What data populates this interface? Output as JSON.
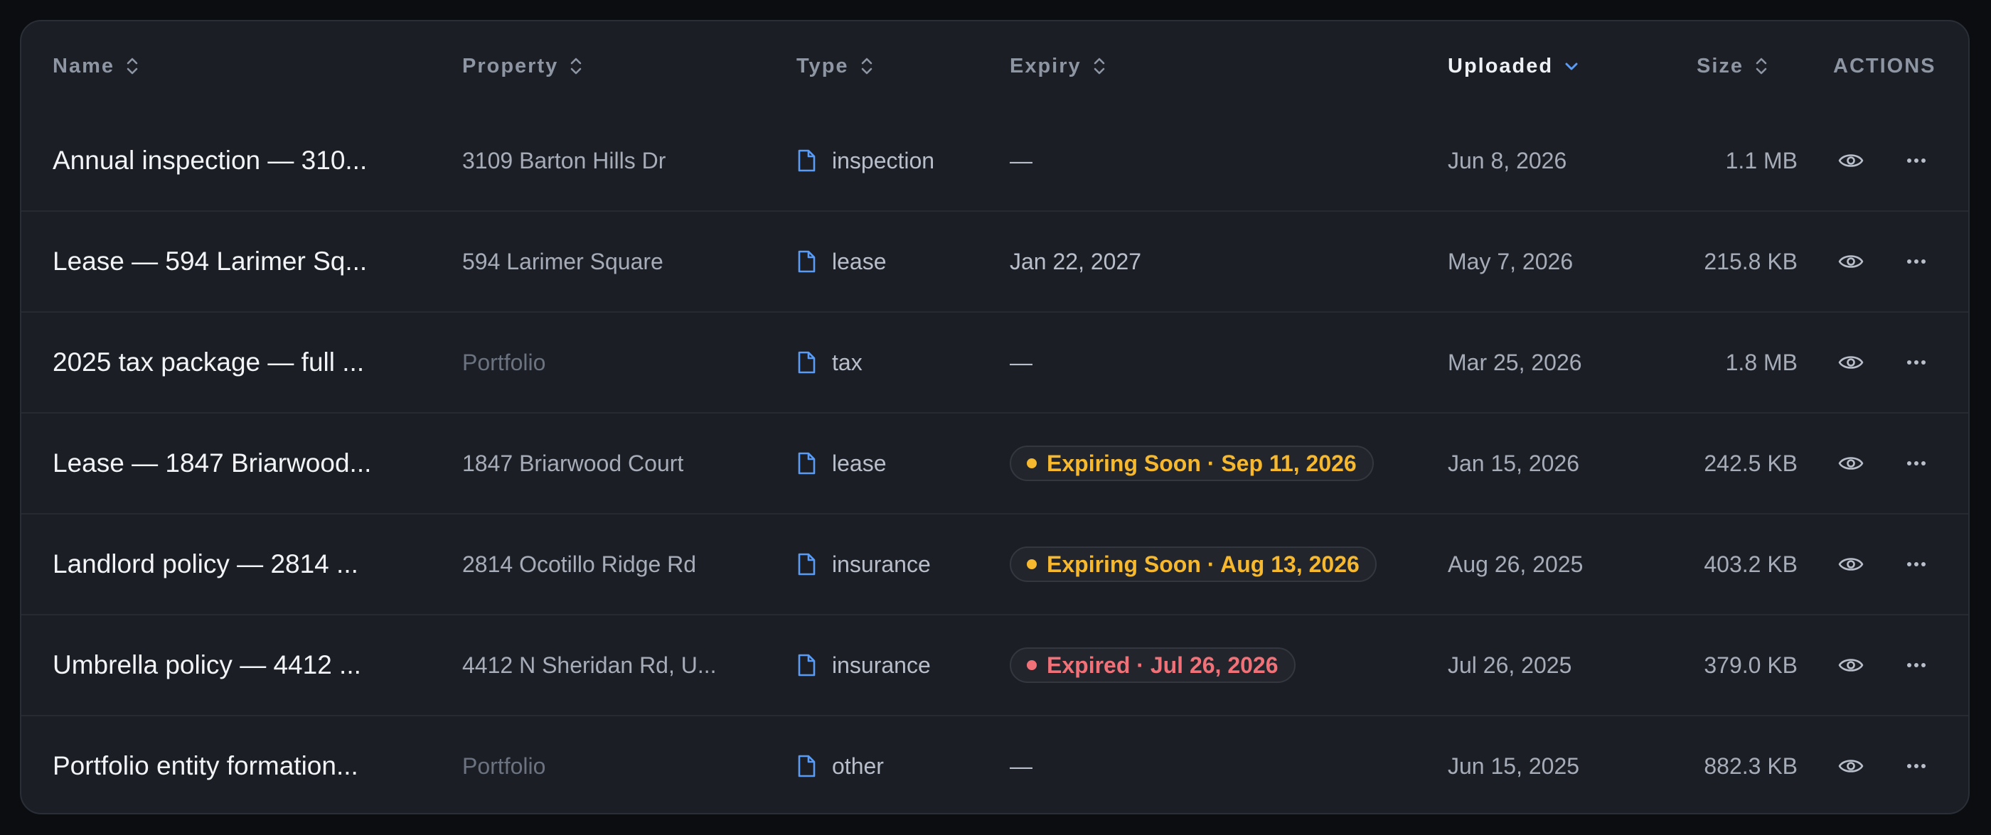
{
  "columns": {
    "name": "Name",
    "property": "Property",
    "type": "Type",
    "expiry": "Expiry",
    "uploaded": "Uploaded",
    "size": "Size",
    "actions": "ACTIONS"
  },
  "colors": {
    "warning": "#f5b82e",
    "danger": "#f07178",
    "accent": "#5a9cf5"
  },
  "rows": [
    {
      "name": "Annual inspection — 310...",
      "property": "3109 Barton Hills Dr",
      "type": "inspection",
      "expiry": "—",
      "uploaded": "Jun 8, 2026",
      "size": "1.1 MB"
    },
    {
      "name": "Lease — 594 Larimer Sq...",
      "property": "594 Larimer Square",
      "type": "lease",
      "expiry": "Jan 22, 2027",
      "uploaded": "May 7, 2026",
      "size": "215.8 KB"
    },
    {
      "name": "2025 tax package — full ...",
      "property": "Portfolio",
      "type": "tax",
      "expiry": "—",
      "uploaded": "Mar 25, 2026",
      "size": "1.8 MB"
    },
    {
      "name": "Lease — 1847 Briarwood...",
      "property": "1847 Briarwood Court",
      "type": "lease",
      "expiry": "Expiring Soon · Sep 11, 2026",
      "uploaded": "Jan 15, 2026",
      "size": "242.5 KB"
    },
    {
      "name": "Landlord policy — 2814 ...",
      "property": "2814 Ocotillo Ridge Rd",
      "type": "insurance",
      "expiry": "Expiring Soon · Aug 13, 2026",
      "uploaded": "Aug 26, 2025",
      "size": "403.2 KB"
    },
    {
      "name": "Umbrella policy — 4412 ...",
      "property": "4412 N Sheridan Rd, U...",
      "type": "insurance",
      "expiry": "Expired · Jul 26, 2026",
      "uploaded": "Jul 26, 2025",
      "size": "379.0 KB"
    },
    {
      "name": "Portfolio entity formation...",
      "property": "Portfolio",
      "type": "other",
      "expiry": "—",
      "uploaded": "Jun 15, 2025",
      "size": "882.3 KB"
    }
  ]
}
